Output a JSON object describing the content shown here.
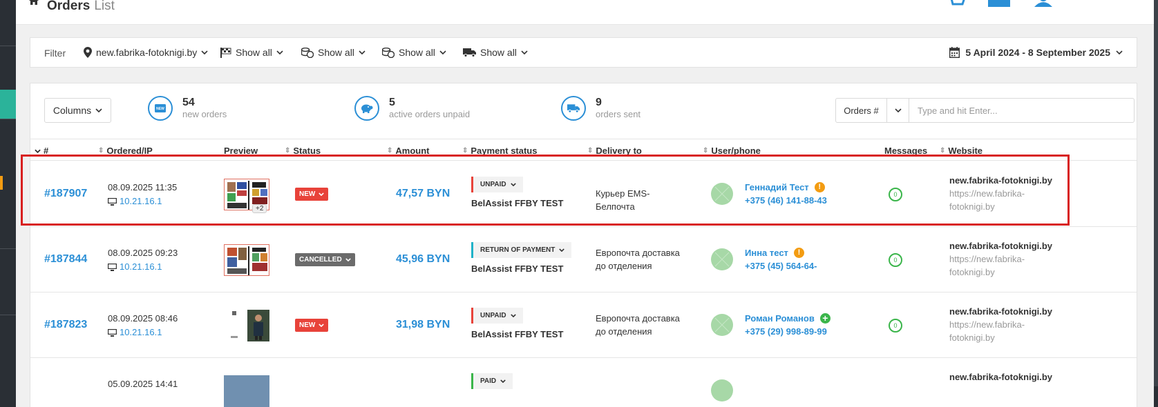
{
  "header": {
    "title": "Orders",
    "subtitle": "List"
  },
  "filter": {
    "label": "Filter",
    "site": "new.fabrika-fotoknigi.by",
    "items": [
      "Show all",
      "Show all",
      "Show all",
      "Show all"
    ],
    "date_range": "5 April 2024 - 8 September 2025"
  },
  "toolbar": {
    "columns_label": "Columns"
  },
  "stats": [
    {
      "icon": "new-icon",
      "num": "54",
      "label": "new orders"
    },
    {
      "icon": "piggy-bank-icon",
      "num": "5",
      "label": "active orders unpaid"
    },
    {
      "icon": "truck-icon",
      "num": "9",
      "label": "orders sent"
    }
  ],
  "search": {
    "select_label": "Orders #",
    "placeholder": "Type and hit Enter..."
  },
  "columns": [
    "#",
    "Ordered/IP",
    "Preview",
    "Status",
    "Amount",
    "Payment status",
    "Delivery to",
    "User/phone",
    "Messages",
    "Website"
  ],
  "orders": [
    {
      "id": "#187907",
      "date": "08.09.2025 11:35",
      "ip": "10.21.16.1",
      "preview_extra": "+2",
      "status": "NEW",
      "amount": "47,57 BYN",
      "pay_status": "UNPAID",
      "pay_system": "BelAssist FFBY TEST",
      "delivery": "Курьер EMS-Белпочта",
      "user": "Геннадий Тест",
      "phone": "+375 (46) 141-88-43",
      "user_flag": "!",
      "messages": "0",
      "site_name": "new.fabrika-fotoknigi.by",
      "site_url": "https://new.fabrika-fotoknigi.by"
    },
    {
      "id": "#187844",
      "date": "08.09.2025 09:23",
      "ip": "10.21.16.1",
      "status": "CANCELLED",
      "amount": "45,96 BYN",
      "pay_status": "RETURN OF PAYMENT",
      "pay_system": "BelAssist FFBY TEST",
      "delivery": "Европочта доставка до отделения",
      "user": "Инна тест",
      "phone": "+375 (45) 564-64-",
      "user_flag": "!",
      "messages": "0",
      "site_name": "new.fabrika-fotoknigi.by",
      "site_url": "https://new.fabrika-fotoknigi.by"
    },
    {
      "id": "#187823",
      "date": "08.09.2025 08:46",
      "ip": "10.21.16.1",
      "status": "NEW",
      "amount": "31,98 BYN",
      "pay_status": "UNPAID",
      "pay_system": "BelAssist FFBY TEST",
      "delivery": "Европочта доставка до отделения",
      "user": "Роман Романов",
      "phone": "+375 (29) 998-89-99",
      "user_flag": "+",
      "messages": "0",
      "site_name": "new.fabrika-fotoknigi.by",
      "site_url": "https://new.fabrika-fotoknigi.by"
    },
    {
      "date": "05.09.2025 14:41",
      "pay_status": "PAID",
      "site_name": "new.fabrika-fotoknigi.by"
    }
  ],
  "colors": {
    "accent": "#2b8fd6",
    "danger": "#e8433a",
    "success": "#3ab54a",
    "warning": "#f39c12",
    "highlight": "#d81e1e"
  }
}
